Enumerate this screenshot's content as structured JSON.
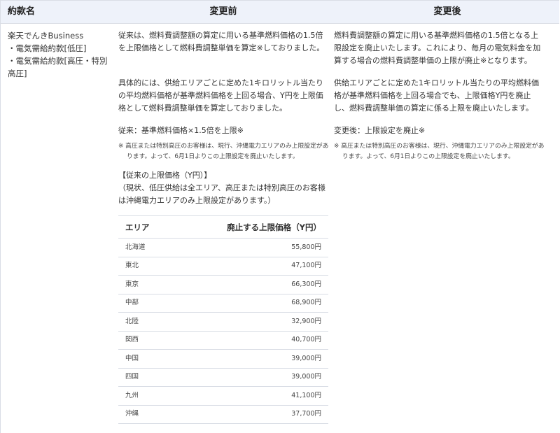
{
  "header": {
    "col1": "約款名",
    "col2": "変更前",
    "col3": "変更後"
  },
  "contract": {
    "lines": [
      "楽天でんきBusiness",
      "・電気需給約款[低圧]",
      "・電気需給約款[高圧・特別",
      "高圧]"
    ]
  },
  "before": {
    "p1": "従来は、燃料費調整額の算定に用いる基準燃料価格の1.5倍を上限価格として燃料費調整単価を算定※しておりました。",
    "p2": "具体的には、供給エリアごとに定めた1キロリットル当たりの平均燃料価格が基準燃料価格を上回る場合、Y円を上限価格として燃料費調整単価を算定しておりました。",
    "formula": "従来：基準燃料価格×1.5倍を上限※",
    "note": "※ 高圧または特別高圧のお客様は、現行、沖縄電力エリアのみ上限設定があります。よって、6月1日よりこの上限設定を廃止いたします。",
    "table_title": "【従来の上限価格（Y円）】",
    "table_sub": "（現状、低圧供給は全エリア、高圧または特別高圧のお客様は沖縄電力エリアのみ上限設定があります。）",
    "table": {
      "h_area": "エリア",
      "h_price": "廃止する上限価格（Y円）",
      "rows": [
        {
          "area": "北海道",
          "price": "55,800円"
        },
        {
          "area": "東北",
          "price": "47,100円"
        },
        {
          "area": "東京",
          "price": "66,300円"
        },
        {
          "area": "中部",
          "price": "68,900円"
        },
        {
          "area": "北陸",
          "price": "32,900円"
        },
        {
          "area": "関西",
          "price": "40,700円"
        },
        {
          "area": "中国",
          "price": "39,000円"
        },
        {
          "area": "四国",
          "price": "39,000円"
        },
        {
          "area": "九州",
          "price": "41,100円"
        },
        {
          "area": "沖縄",
          "price": "37,700円"
        }
      ]
    }
  },
  "after": {
    "p1": "燃料費調整額の算定に用いる基準燃料価格の1.5倍となる上限設定を廃止いたします。これにより、毎月の電気料金を加算する場合の燃料費調整単価の上限が廃止※となります。",
    "p2": "供給エリアごとに定めた1キロリットル当たりの平均燃料価格が基準燃料価格を上回る場合でも、上限価格Y円を廃止し、燃料費調整単価の算定に係る上限を廃止いたします。",
    "formula": "変更後：上限設定を廃止※",
    "note": "※ 高圧または特別高圧のお客様は、現行、沖縄電力エリアのみ上限設定があります。よって、6月1日よりこの上限設定を廃止いたします。"
  }
}
